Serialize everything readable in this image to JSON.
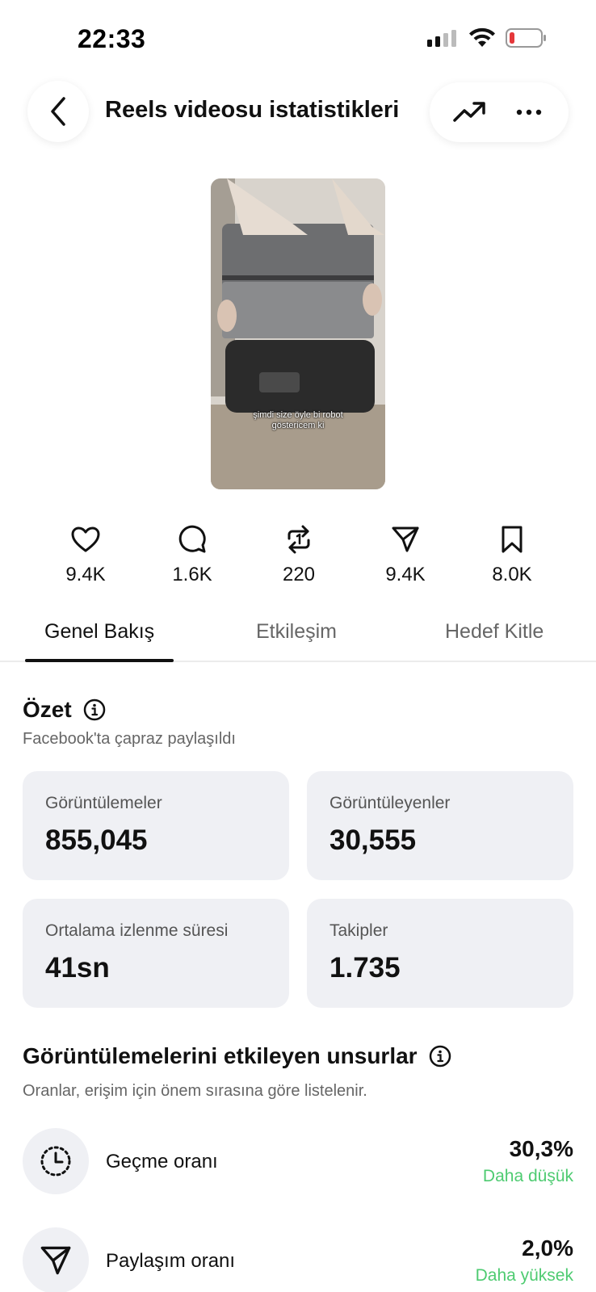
{
  "status_bar": {
    "time": "22:33"
  },
  "header": {
    "title": "Reels videosu istatistikleri"
  },
  "video": {
    "caption_line1": "şimdi size öyle bi robot",
    "caption_line2": "göstericem ki"
  },
  "stats": [
    {
      "icon": "heart-icon",
      "value": "9.4K"
    },
    {
      "icon": "comment-icon",
      "value": "1.6K"
    },
    {
      "icon": "repost-icon",
      "value": "220"
    },
    {
      "icon": "share-icon",
      "value": "9.4K"
    },
    {
      "icon": "bookmark-icon",
      "value": "8.0K"
    }
  ],
  "tabs": [
    {
      "label": "Genel Bakış",
      "active": true
    },
    {
      "label": "Etkileşim",
      "active": false
    },
    {
      "label": "Hedef Kitle",
      "active": false
    }
  ],
  "summary": {
    "title": "Özet",
    "subtitle": "Facebook'ta çapraz paylaşıldı",
    "cards": [
      {
        "label": "Görüntülemeler",
        "value": "855,045"
      },
      {
        "label": "Görüntüleyenler",
        "value": "30,555"
      },
      {
        "label": "Ortalama izlenme süresi",
        "value": "41sn"
      },
      {
        "label": "Takipler",
        "value": "1.735"
      }
    ]
  },
  "factors": {
    "title": "Görüntülemelerini etkileyen unsurlar",
    "subtitle": "Oranlar, erişim için önem sırasına göre listelenir.",
    "items": [
      {
        "icon": "dotted-clock-icon",
        "label": "Geçme oranı",
        "value": "30,3%",
        "trend": "Daha düşük"
      },
      {
        "icon": "send-icon",
        "label": "Paylaşım oranı",
        "value": "2,0%",
        "trend": "Daha yüksek"
      }
    ]
  },
  "colors": {
    "trend_green": "#4ecb71",
    "card_bg": "#eff0f4",
    "battery_low": "#e5383b"
  }
}
